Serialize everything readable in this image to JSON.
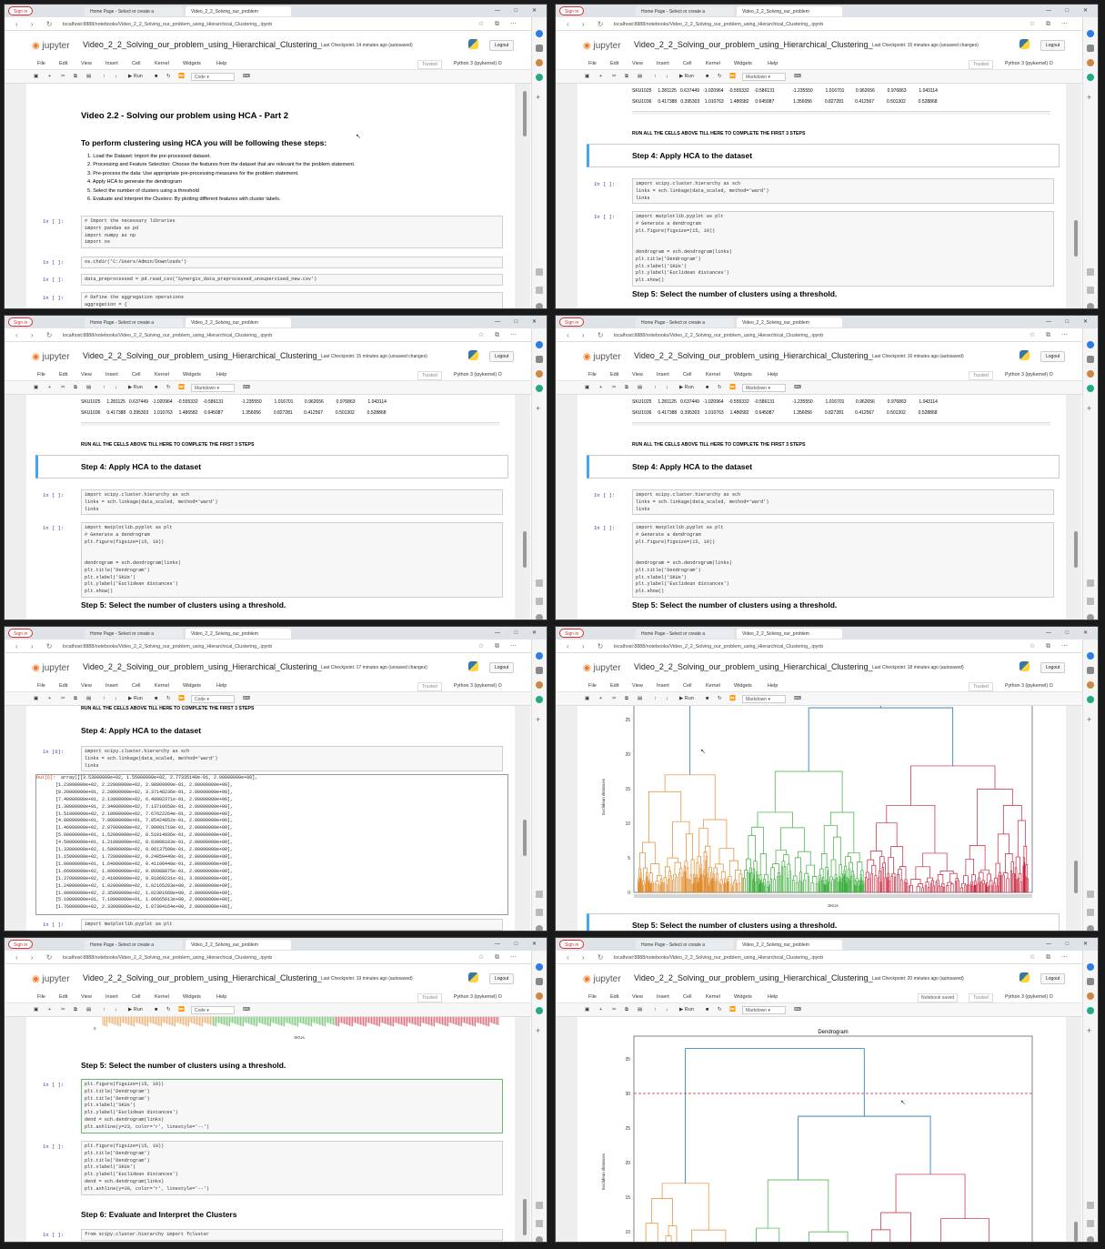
{
  "browser": {
    "sign_in": "Sign in",
    "tab1": "Home Page - Select or create a",
    "tab2": "Video_2_2_Solving_our_problem",
    "url": "localhost:8888/notebooks/Video_2_2_Solving_our_problem_using_Hierarchical_Clustering_.ipynb",
    "window_controls": "— □ ✕"
  },
  "jupyter": {
    "logo": "jupyter",
    "title": "Video_2_2_Solving_our_problem_using_Hierarchical_Clustering_",
    "logout": "Logout",
    "trusted": "Trusted",
    "kernel": "Python 3 (ipykernel) O",
    "menu": [
      "File",
      "Edit",
      "View",
      "Insert",
      "Cell",
      "Kernel",
      "Widgets",
      "Help"
    ],
    "run": "Run",
    "notebook_saved": "Notebook saved"
  },
  "panels": [
    {
      "checkpoint": "Last Checkpoint: 14 minutes ago",
      "status": "(autosaved)",
      "cell_type": "Code"
    },
    {
      "checkpoint": "Last Checkpoint: 15 minutes ago",
      "status": "(unsaved changes)",
      "cell_type": "Markdown"
    },
    {
      "checkpoint": "Last Checkpoint: 15 minutes ago",
      "status": "(unsaved changes)",
      "cell_type": "Markdown"
    },
    {
      "checkpoint": "Last Checkpoint: 16 minutes ago",
      "status": "(autosaved)",
      "cell_type": "Markdown"
    },
    {
      "checkpoint": "Last Checkpoint: 17 minutes ago",
      "status": "(unsaved changes)",
      "cell_type": "Code"
    },
    {
      "checkpoint": "Last Checkpoint: 18 minutes ago",
      "status": "(autosaved)",
      "cell_type": "Markdown"
    },
    {
      "checkpoint": "Last Checkpoint: 19 minutes ago",
      "status": "(autosaved)",
      "cell_type": "Code"
    },
    {
      "checkpoint": "Last Checkpoint: 20 minutes ago",
      "status": "(autosaved)",
      "cell_type": "Markdown"
    }
  ],
  "intro": {
    "heading": "Video 2.2 - Solving our problem using HCA - Part 2",
    "subheading": "To perform clustering using HCA you will be following these steps:",
    "steps": [
      "1. Load the Dataset: Import the pre-processed dataset.",
      "2. Processing and Feature Selection: Choose the features from the dataset that are relevant for the problem statement.",
      "3. Pre-process the data: Use appropriate pre-processing measures for the problem statement.",
      "4. Apply HCA to generate the dendrogram",
      "5. Select the number of clusters using a threshold",
      "6. Evaluate and Interpret the Clusters: By plotting different features with cluster labels."
    ],
    "code_imports": "# Import the necessary libraries\nimport pandas as pd\nimport numpy as np\nimport os",
    "code_chdir": "os.chdir('C:/Users/Admin/Downloads')",
    "code_read": "data_preprocessed = pd.read_csv('Synergix_data_preprocessed_unsupervised_new.csv')",
    "code_agg": "# Define the aggregation operations\naggregation = {"
  },
  "table_rows": [
    "SKU1025     1.281125   0.637449   -1.020964    -0.555332    -0.586131              -1.235550          1.016701         0.962656          0.976863          1.043114",
    "SKU1036     0.417388   0.395303    1.010763     1.486582     0.645087               1.356056          0.827281         0.412567          0.501302          0.528868"
  ],
  "run_all": "RUN ALL THE CELLS ABOVE TILL HERE TO COMPLETE THE FIRST 3 STEPS",
  "step4": "Step 4: Apply HCA to the dataset",
  "step5": "Step 5: Select the number of clusters using a threshold.",
  "step6": "Step 6: Evaluate and Interpret the Clusters",
  "code_linkage": "import scipy.cluster.hierarchy as sch\nlinks = sch.linkage(data_scaled, method='ward')\nlinks",
  "code_dendro": "import matplotlib.pyplot as plt\n# Generate a dendrogram\nplt.figure(figsize=(15, 10))\n\n\ndendrogram = sch.dendrogram(links)\nplt.title('Dendrogram')\nplt.xlabel('SKUs')\nplt.ylabel('Euclidean distances')\nplt.show()",
  "code_thresh1": "plt.figure(figsize=(15, 10))\nplt.title('Dendrogram')\nplt.title('Dendrogram')\nplt.xlabel('SKUs')\nplt.ylabel('Euclidean distances')\ndend = sch.dendrogram(links)\nplt.axhline(y=23, color='r', linestyle='--')",
  "code_thresh2": "plt.figure(figsize=(15, 10))\nplt.title('Dendrogram')\nplt.title('Dendrogram')\nplt.xlabel('SKUs')\nplt.ylabel('Euclidean distances')\ndend = sch.dendrogram(links)\nplt.axhline(y=30, color='r', linestyle='--')",
  "code_fcluster": "from scipy.cluster.hierarchy import fcluster",
  "code_matplot": "import matplotlib.pyplot as plt",
  "prompt_empty": "In [ ]:",
  "prompt_6": "In [6]:",
  "out_6": "Out[6]:",
  "array_output": "array([[3.53000000e+02, 1.55000000e+02, 2.77335140e-01, 2.00000000e+00],\n       [1.23000000e+02, 2.22000000e+02, 2.98009999e-01, 2.00000000e+00],\n       [8.20000000e+01, 2.28000000e+02, 3.37148236e-01, 2.00000000e+00],\n       [7.40000000e+01, 2.13000000e+02, 6.48002371e-01, 2.00000000e+00],\n       [1.30000000e+01, 2.34000000e+02, 7.13710658e-01, 2.00000000e+00],\n       [1.51000000e+02, 2.18000000e+02, 7.67622264e-01, 2.00000000e+00],\n       [4.80000000e+01, 7.80000000e+01, 7.85424852e-01, 2.00000000e+00],\n       [1.46000000e+02, 2.07000000e+02, 7.99001719e-01, 2.00000000e+00],\n       [5.00000000e+01, 1.52000000e+02, 8.51014936e-01, 2.00000000e+00],\n       [4.50000000e+01, 1.21000000e+02, 8.93908183e-01, 2.00000000e+00],\n       [1.33000000e+02, 1.59000000e+02, 9.06137590e-01, 2.00000000e+00],\n       [1.15000000e+02, 1.72000000e+02, 9.24859449e-01, 2.00000000e+00],\n       [1.00000000e+01, 1.64000000e+02, 9.41100440e-01, 2.00000000e+00],\n       [1.66000000e+02, 1.89000000e+02, 9.86988875e-01, 2.00000000e+00],\n       [1.37000000e+02, 2.41000000e+02, 9.91869231e-01, 3.00000000e+00],\n       [1.24000000e+02, 1.92000000e+02, 1.02165203e+00, 2.00000000e+00],\n       [1.90000000e+02, 2.35000000e+02, 1.02301668e+00, 2.00000000e+00],\n       [5.10000000e+01, 7.10000000e+01, 1.06665013e+00, 2.00000000e+00],\n       [1.76000000e+02, 2.33000000e+02, 1.07304164e+00, 2.00000000e+00],",
  "dendro": {
    "title": "Dendrogram",
    "ylabel": "Euclidean distances",
    "xlabel": "SKUs",
    "yticks_6": [
      "25",
      "20",
      "15",
      "10",
      "5",
      "0"
    ],
    "yticks_8": [
      "35",
      "30",
      "25",
      "20",
      "15",
      "10"
    ],
    "colors": {
      "orange": "#e08a2c",
      "green": "#3aad3a",
      "red": "#c8203a",
      "blue": "#1f77b4",
      "threshold": "#c8203a"
    },
    "threshold": 30
  }
}
